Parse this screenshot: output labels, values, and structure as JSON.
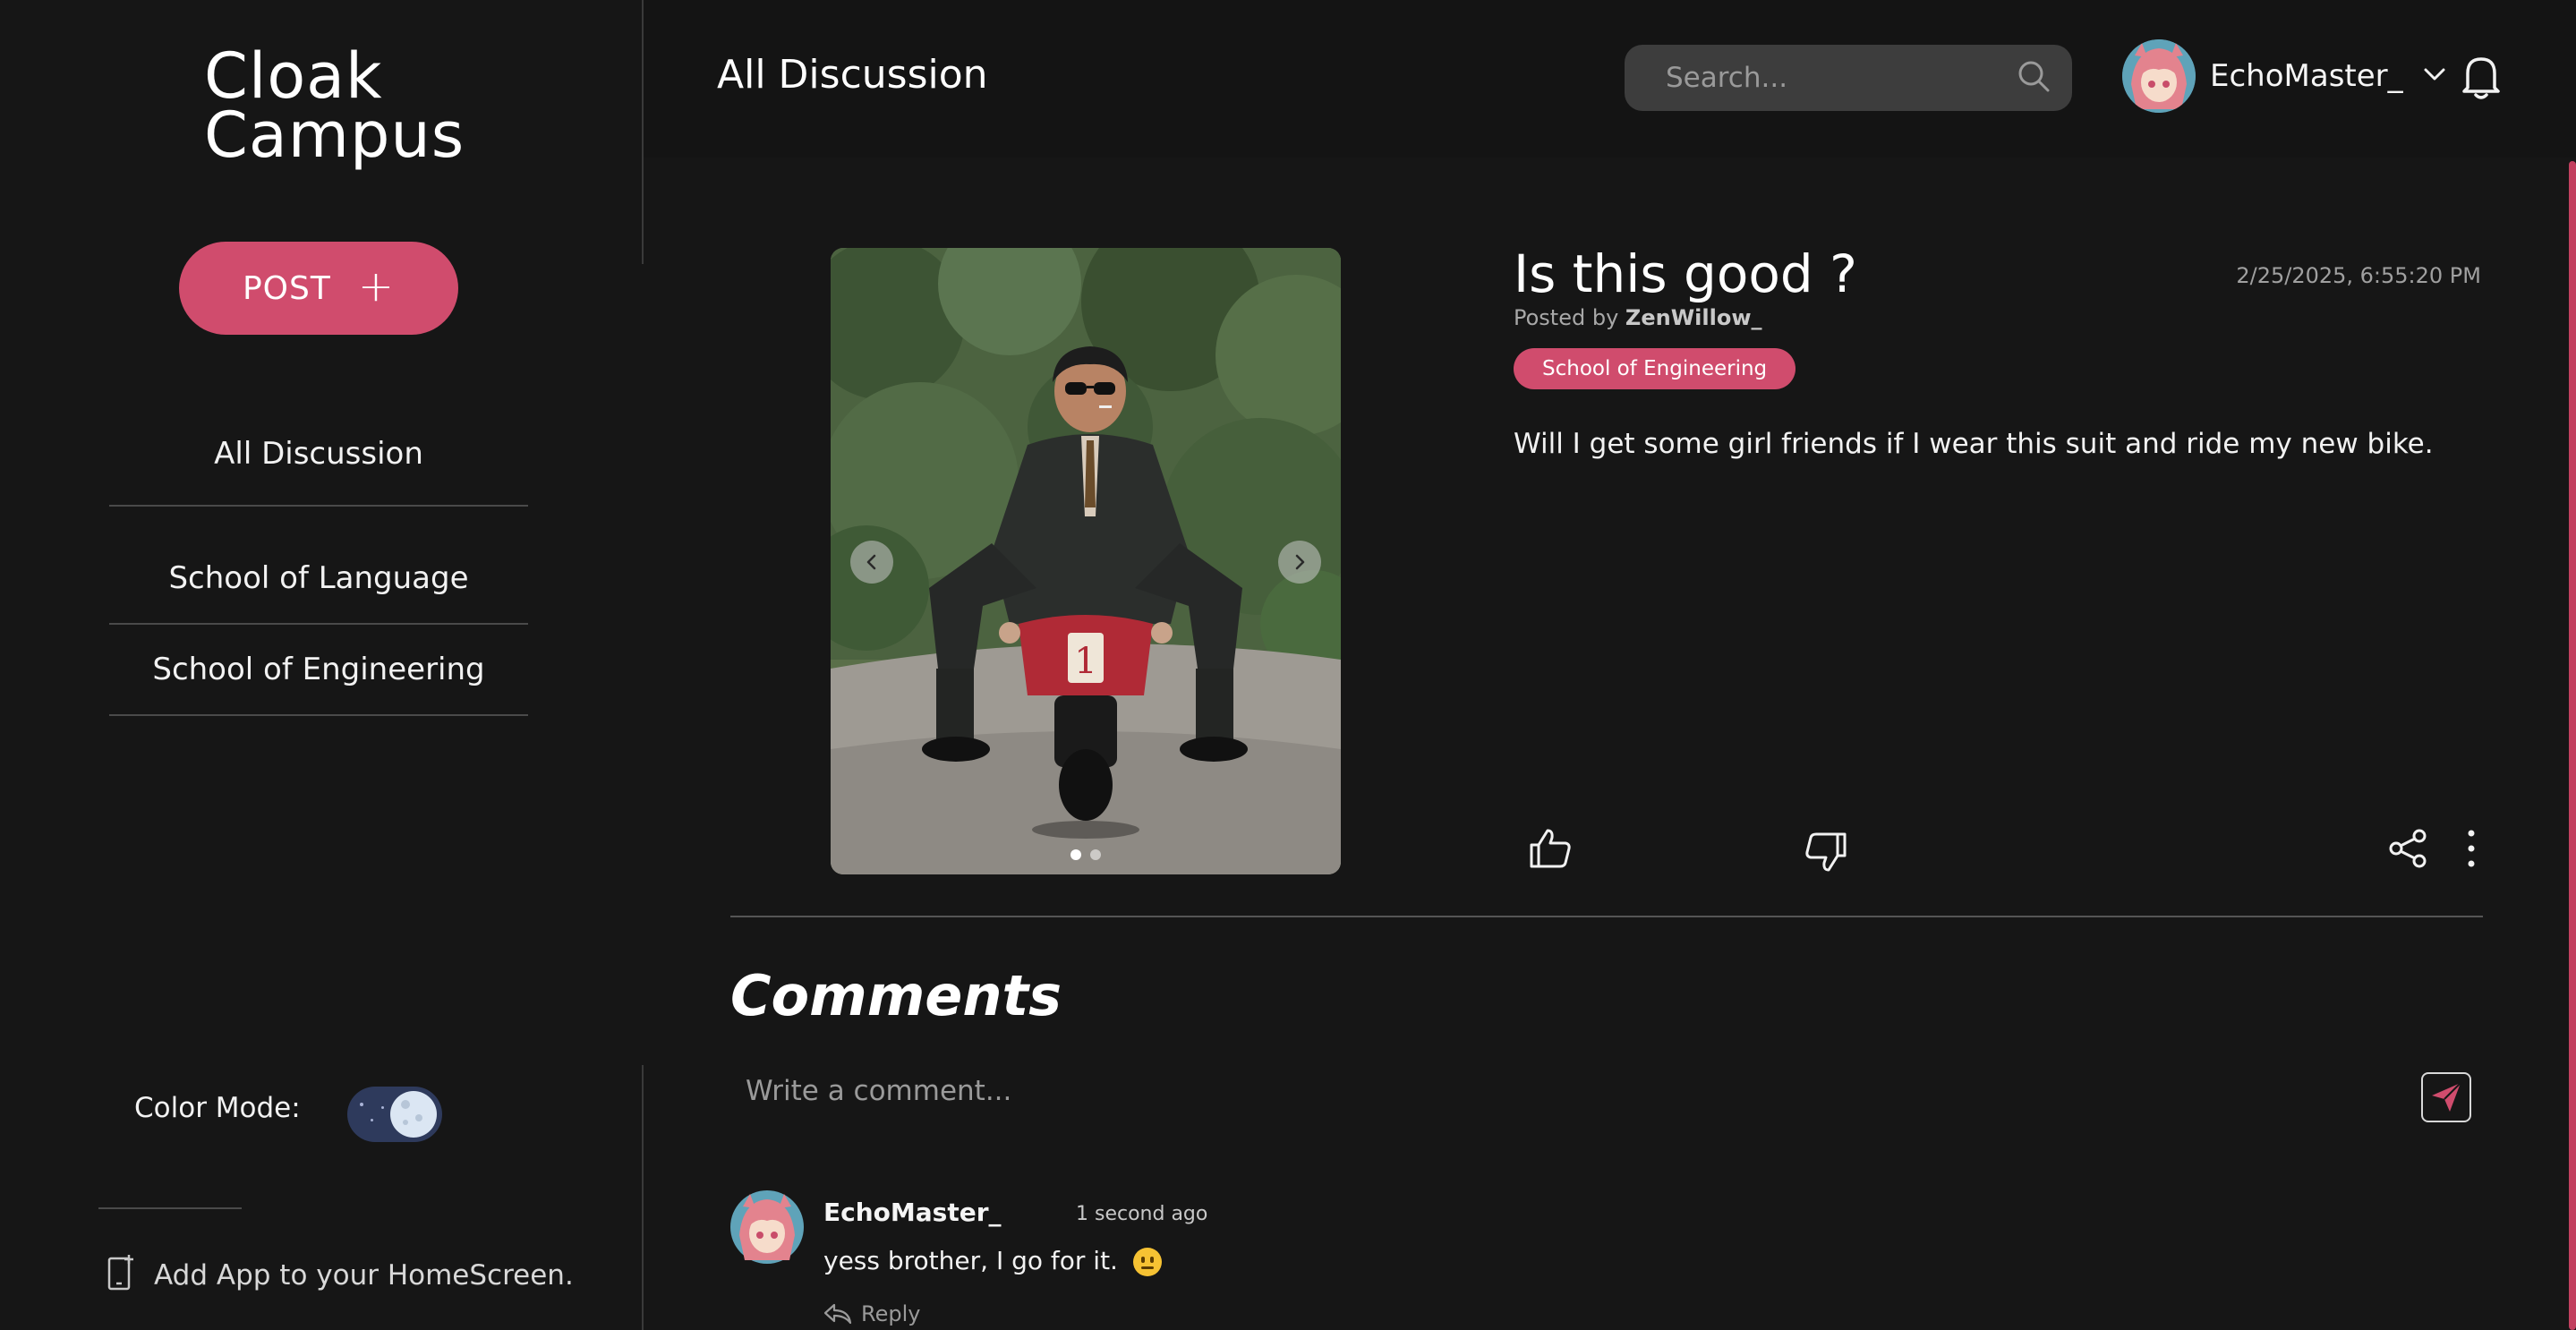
{
  "app": {
    "logo_line1": "Cloak",
    "logo_line2": "Campus"
  },
  "sidebar": {
    "post_button_label": "POST",
    "nav": [
      {
        "label": "All Discussion"
      },
      {
        "label": "School of Language"
      },
      {
        "label": "School of Engineering"
      }
    ],
    "color_mode_label": "Color Mode:",
    "color_mode_state": "dark",
    "add_app_label": "Add App to your HomeScreen."
  },
  "header": {
    "title": "All Discussion",
    "search_placeholder": "Search...",
    "username": "EchoMaster_"
  },
  "post": {
    "title": "Is this good ?",
    "date": "2/25/2025, 6:55:20 PM",
    "posted_by_prefix": "Posted by",
    "author": "ZenWillow_",
    "tag": "School of Engineering",
    "body": "Will I get some girl friends if I wear this suit and ride my new bike.",
    "image_count": 2,
    "active_image": 1
  },
  "comments": {
    "title": "Comments",
    "input_placeholder": "Write a comment...",
    "items": [
      {
        "author": "EchoMaster_",
        "time": "1 second ago",
        "text": "yess brother, I go for it.",
        "reply_label": "Reply"
      }
    ]
  },
  "colors": {
    "accent": "#d04c6d",
    "background": "#161616",
    "header_background": "#141414"
  }
}
